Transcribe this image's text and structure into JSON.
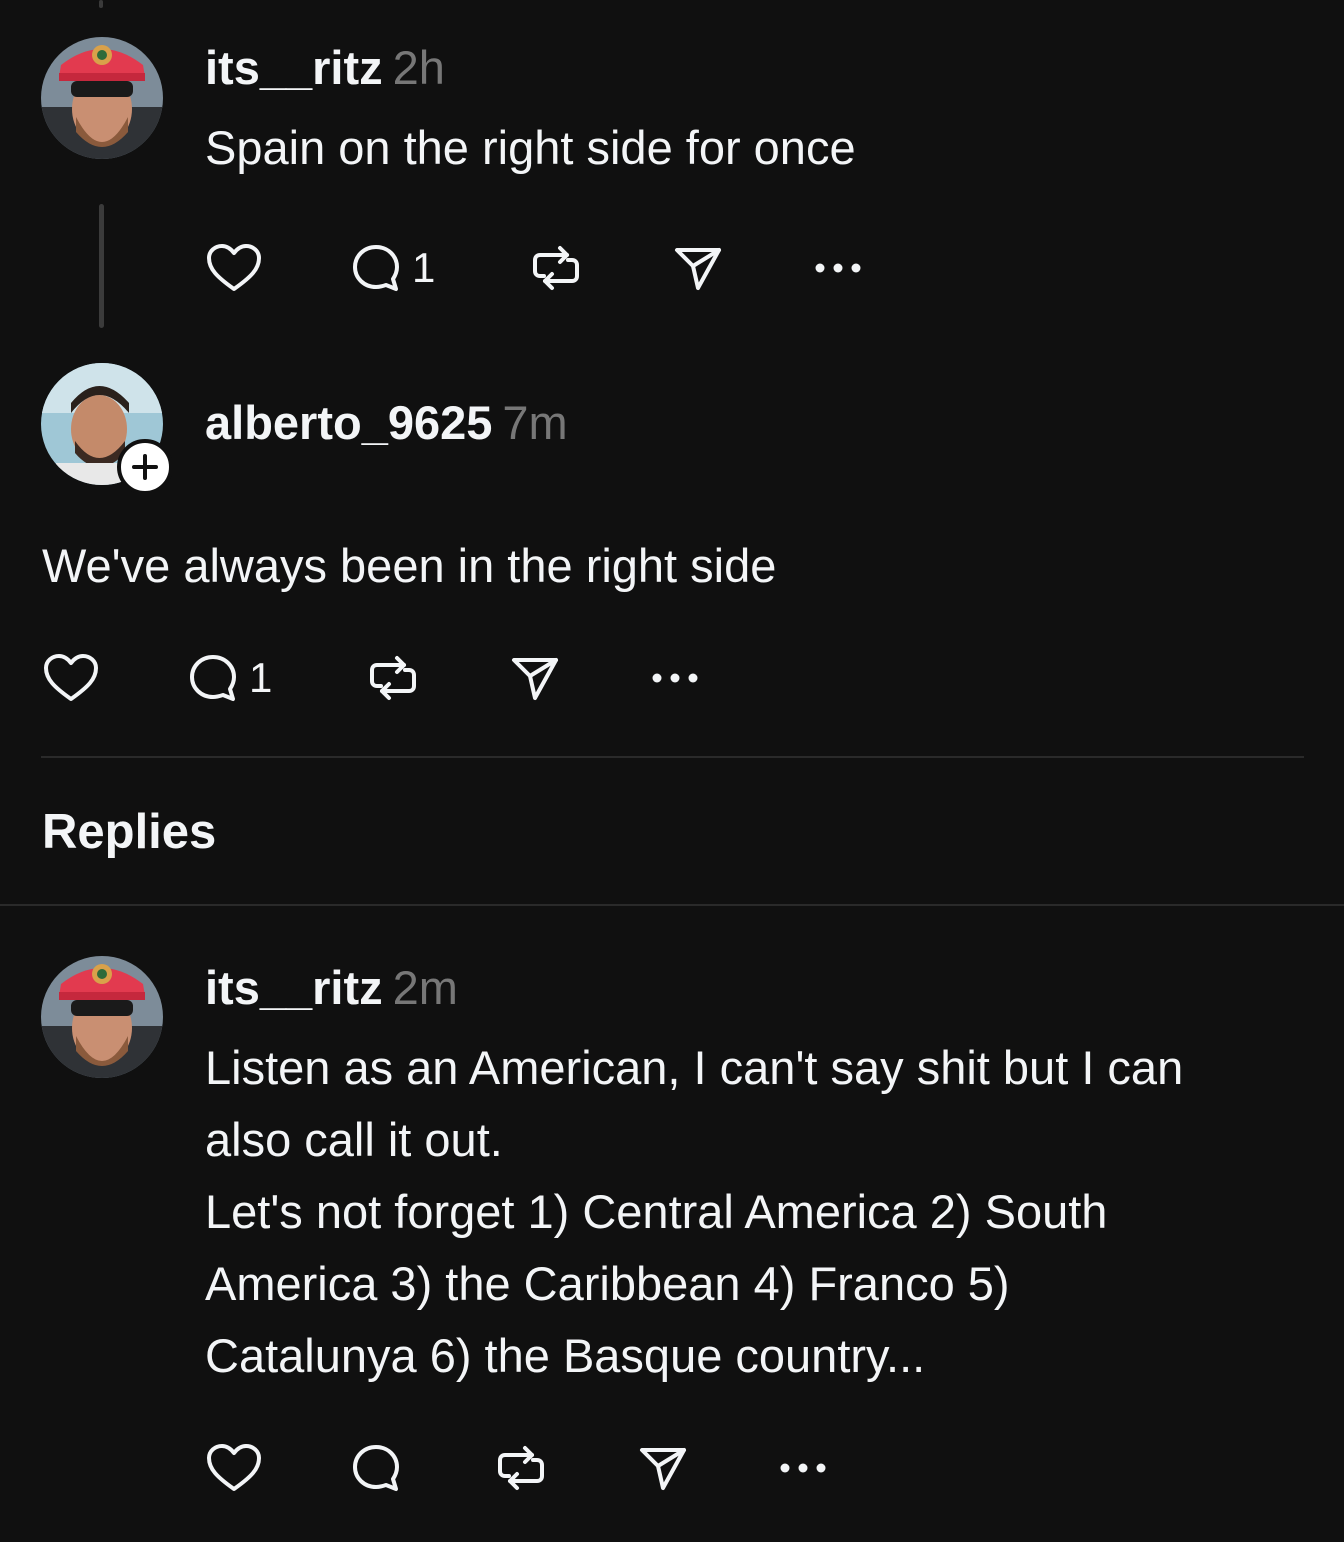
{
  "posts": [
    {
      "username": "its__ritz",
      "time": "2h",
      "text": "Spain on the right side for once",
      "reply_count": "1",
      "avatar_icon": "avatar-photo"
    },
    {
      "username": "alberto_9625",
      "time": "7m",
      "text": "We've always been in the right side",
      "reply_count": "1",
      "avatar_icon": "avatar-photo"
    }
  ],
  "replies_section": {
    "title": "Replies"
  },
  "replies": [
    {
      "username": "its__ritz",
      "time": "2m",
      "text_lines": [
        "Listen as an American, I can't say shit but I can",
        "also call it out.",
        "Let's not forget 1) Central America 2) South",
        "America 3) the Caribbean 4) Franco 5)",
        "Catalunya 6) the Basque country..."
      ],
      "reply_count": ""
    }
  ],
  "icons": {
    "like": "heart-icon",
    "comment": "comment-icon",
    "repost": "repost-icon",
    "share": "send-icon",
    "more": "more-icon",
    "follow": "plus-icon"
  },
  "colors": {
    "background": "#101010",
    "text": "#f3f5f7",
    "muted": "#777777",
    "divider": "#2a2a2a"
  }
}
